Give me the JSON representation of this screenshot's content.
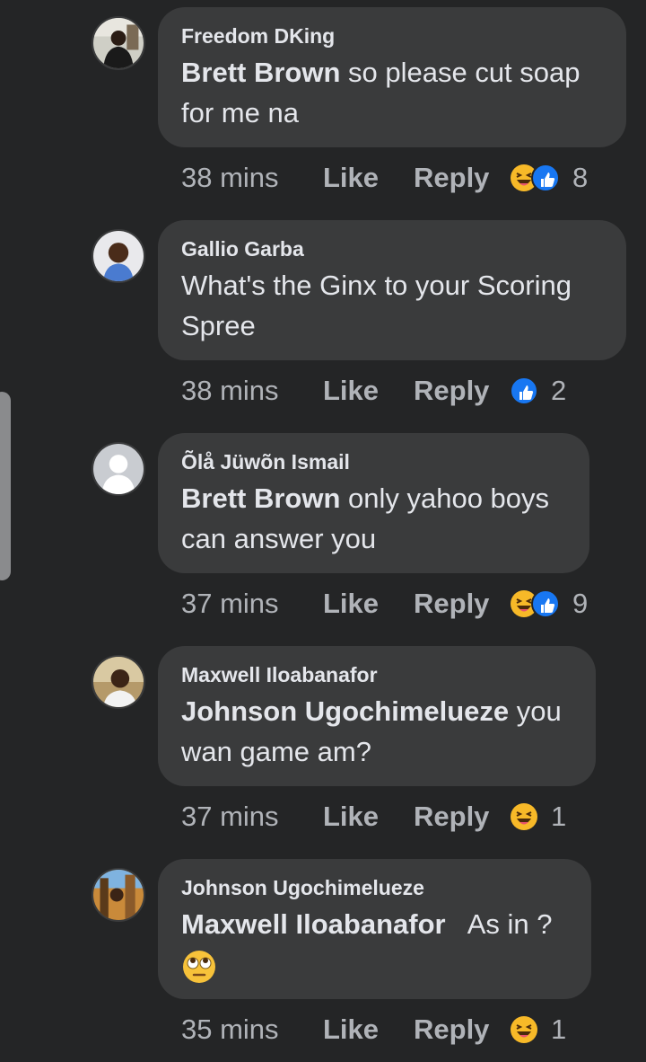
{
  "comments": [
    {
      "author": "Freedom DKing",
      "mention": "Brett Brown",
      "text": " so please cut soap for me na",
      "emoji": "",
      "time": "38 mins",
      "like_label": "Like",
      "reply_label": "Reply",
      "reactions": [
        "haha-icon",
        "like-icon"
      ],
      "reaction_count": "8"
    },
    {
      "author": "Gallio Garba",
      "mention": "",
      "text": "What's the Ginx to your Scoring Spree",
      "emoji": "",
      "time": "38 mins",
      "like_label": "Like",
      "reply_label": "Reply",
      "reactions": [
        "like-icon"
      ],
      "reaction_count": "2"
    },
    {
      "author": "Õlå Jüwõn Ismail",
      "mention": "Brett Brown",
      "text": " only yahoo boys can answer you",
      "emoji": "",
      "time": "37 mins",
      "like_label": "Like",
      "reply_label": "Reply",
      "reactions": [
        "haha-icon",
        "like-icon"
      ],
      "reaction_count": "9"
    },
    {
      "author": "Maxwell Iloabanafor",
      "mention": "Johnson Ugochimelueze",
      "text": " you wan game am?",
      "emoji": "",
      "time": "37 mins",
      "like_label": "Like",
      "reply_label": "Reply",
      "reactions": [
        "haha-icon"
      ],
      "reaction_count": "1"
    },
    {
      "author": "Johnson Ugochimelueze",
      "mention": "Maxwell Iloabanafor",
      "text": "   As in ?",
      "emoji": "eye-roll-emoji",
      "time": "35 mins",
      "like_label": "Like",
      "reply_label": "Reply",
      "reactions": [
        "haha-icon"
      ],
      "reaction_count": "1"
    }
  ],
  "colors": {
    "background": "#242526",
    "bubble": "#3a3b3c",
    "text": "#e4e6eb",
    "meta": "#b0b3b8",
    "like_blue": "#1877f2",
    "haha_yellow": "#f7b928"
  }
}
